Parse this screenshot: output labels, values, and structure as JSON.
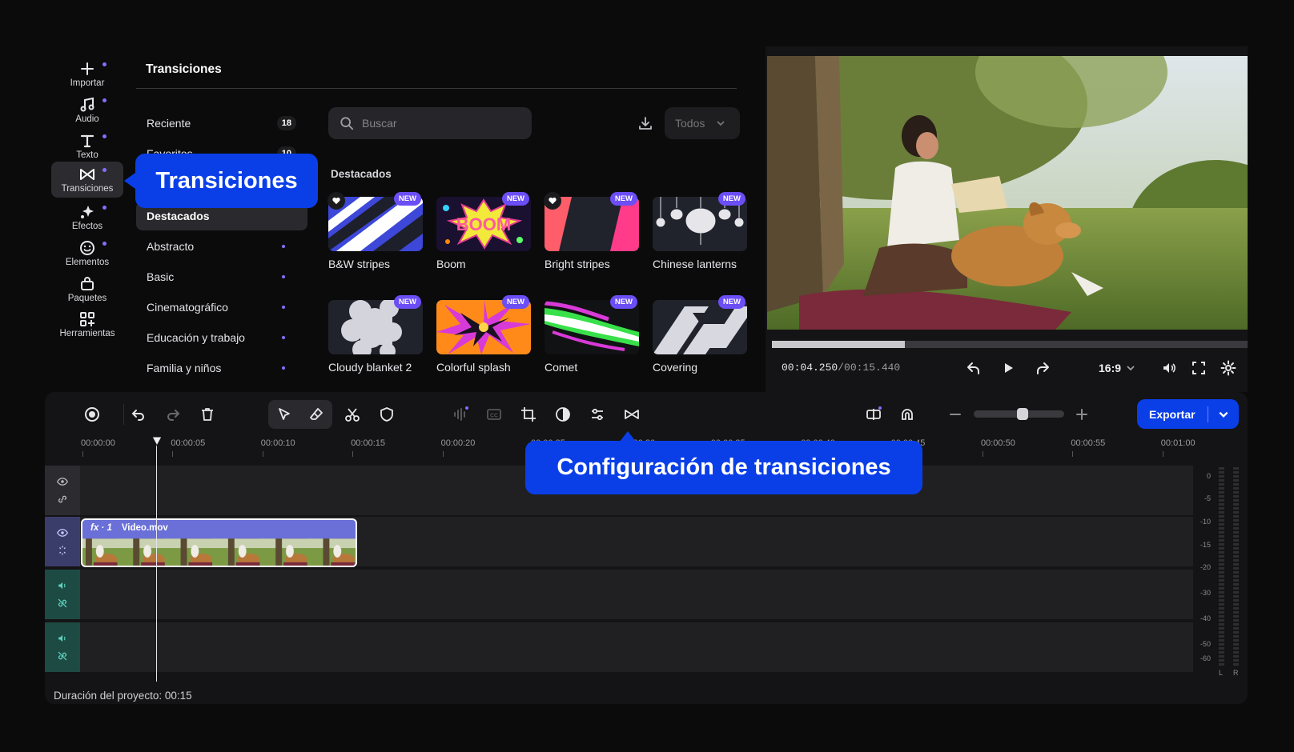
{
  "sidebar": {
    "items": [
      {
        "label": "Importar",
        "icon": "plus-icon"
      },
      {
        "label": "Audio",
        "icon": "music-note-icon"
      },
      {
        "label": "Texto",
        "icon": "text-icon"
      },
      {
        "label": "Transiciones",
        "icon": "transition-icon",
        "active": true
      },
      {
        "label": "Efectos",
        "icon": "sparkle-icon"
      },
      {
        "label": "Elementos",
        "icon": "smiley-icon"
      },
      {
        "label": "Paquetes",
        "icon": "package-icon"
      },
      {
        "label": "Herramientas",
        "icon": "tools-grid-icon"
      }
    ]
  },
  "browser": {
    "title": "Transiciones",
    "categories": [
      {
        "label": "Reciente",
        "count": "18"
      },
      {
        "label": "Favoritos",
        "count": "10"
      },
      {
        "label": "Destacados",
        "selected": true
      },
      {
        "label": "Abstracto"
      },
      {
        "label": "Basic"
      },
      {
        "label": "Cinematográfico"
      },
      {
        "label": "Educación y trabajo"
      },
      {
        "label": "Familia y niños"
      }
    ],
    "search_placeholder": "Buscar",
    "filter_value": "Todos",
    "section_title": "Destacados",
    "badge_text": "NEW",
    "tiles": [
      {
        "name": "B&W stripes",
        "favorite": true
      },
      {
        "name": "Boom"
      },
      {
        "name": "Bright stripes",
        "favorite": true
      },
      {
        "name": "Chinese lanterns"
      },
      {
        "name": "Cloudy blanket 2"
      },
      {
        "name": "Colorful splash"
      },
      {
        "name": "Comet"
      },
      {
        "name": "Covering"
      }
    ]
  },
  "callouts": {
    "transitions": "Transiciones",
    "config": "Configuración de transiciones"
  },
  "preview": {
    "progress": 0.279,
    "time_current": "00:04.250",
    "time_total": "/00:15.440",
    "aspect_ratio": "16:9"
  },
  "timeline": {
    "export_label": "Exportar",
    "zoom_level": 0.55,
    "ruler": [
      "00:00:00",
      "00:00:05",
      "00:00:10",
      "00:00:15",
      "00:00:20",
      "00:00:25",
      "00:00:30",
      "00:00:35",
      "00:00:40",
      "00:00:45",
      "00:00:50",
      "00:00:55",
      "00:01:00"
    ],
    "clip_fx": "fx · 1",
    "clip_name": "Video.mov",
    "meter_labels": [
      "0",
      "-5",
      "-10",
      "-15",
      "-20",
      "-30",
      "-40",
      "-50",
      "-60"
    ],
    "meter_channels": [
      "L",
      "R"
    ],
    "project_duration": "Duración del proyecto: 00:15"
  },
  "colors": {
    "accent": "#0a3fe8",
    "badge": "#6b4ef5",
    "clip": "#6a70d8",
    "audio_track": "#5bd6c0"
  }
}
